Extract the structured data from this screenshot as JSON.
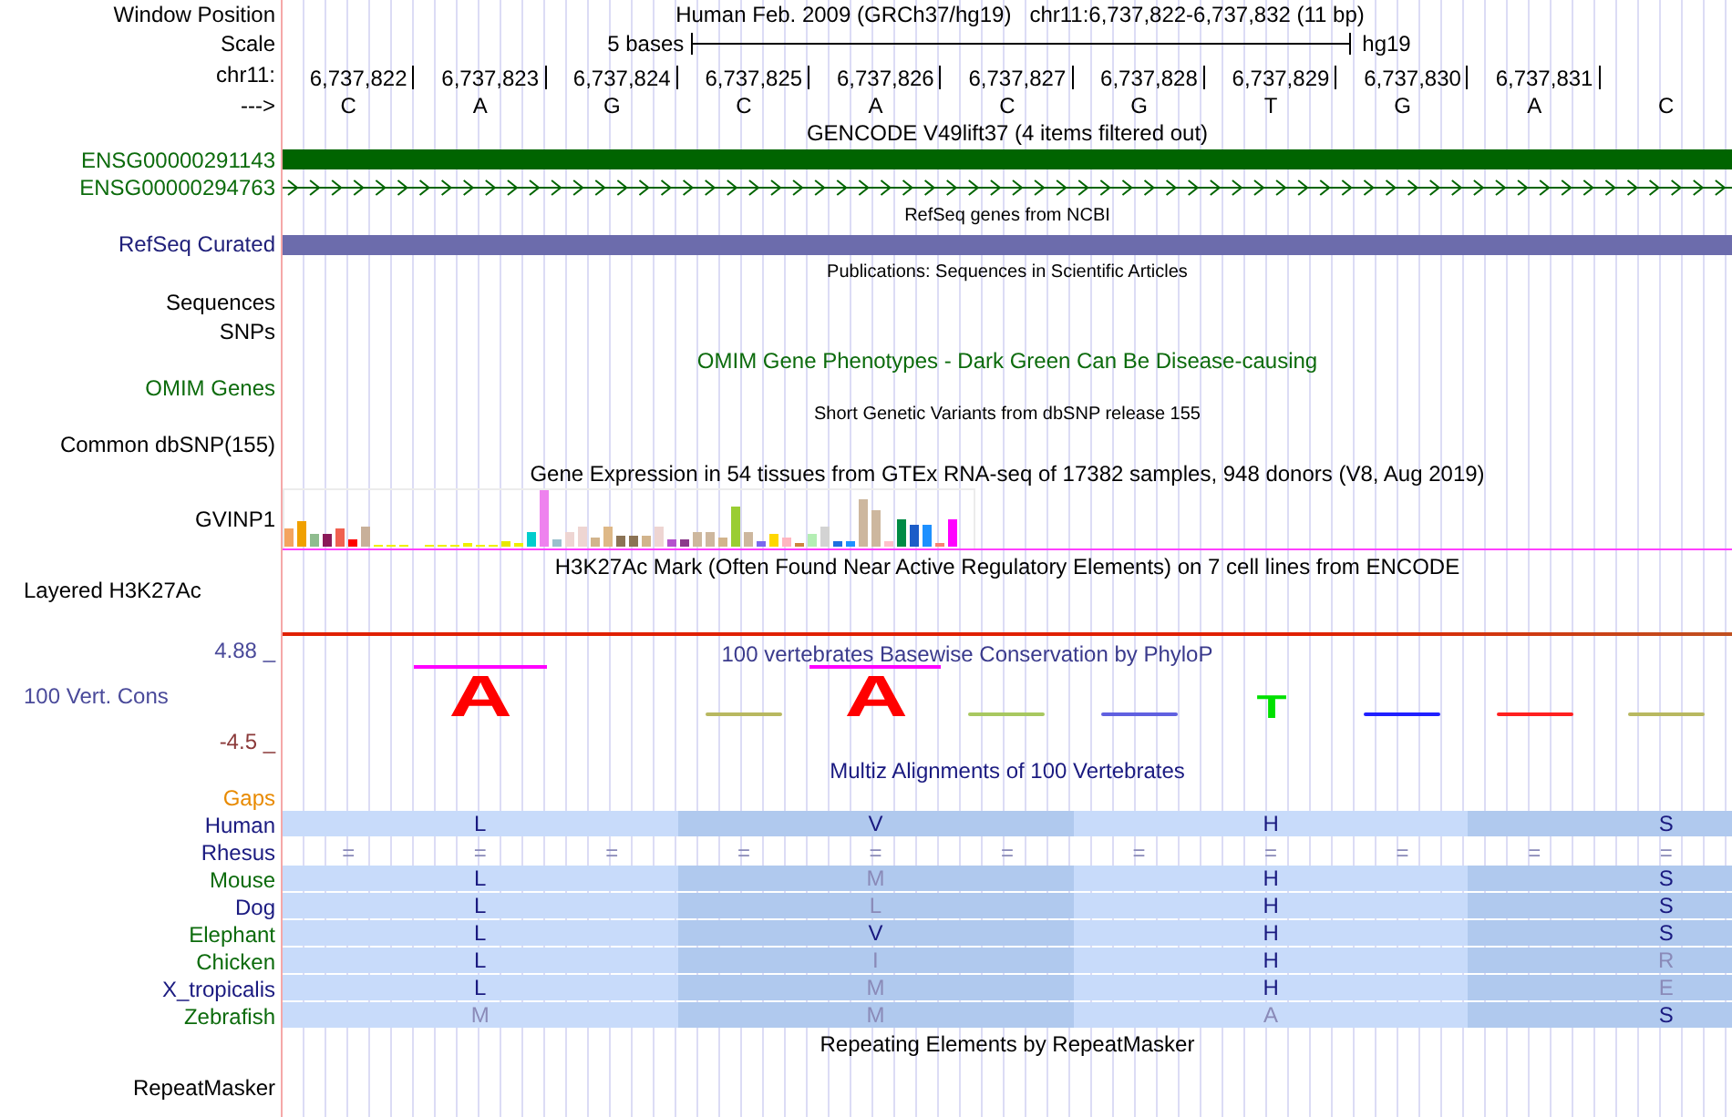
{
  "header": {
    "label": "Window Position",
    "assembly": "Human Feb. 2009 (GRCh37/hg19)",
    "region": "chr11:6,737,822-6,737,832 (11 bp)"
  },
  "scale": {
    "label": "Scale",
    "span": "5 bases",
    "assembly": "hg19"
  },
  "ruler": {
    "label": "chr11:",
    "positions": [
      "6,737,822",
      "6,737,823",
      "6,737,824",
      "6,737,825",
      "6,737,826",
      "6,737,827",
      "6,737,828",
      "6,737,829",
      "6,737,830",
      "6,737,831"
    ]
  },
  "sequence": {
    "label": "--->",
    "bases": [
      "C",
      "A",
      "G",
      "C",
      "A",
      "C",
      "G",
      "T",
      "G",
      "A",
      "C"
    ]
  },
  "rows": [
    {
      "kind": "title",
      "title": {
        "kind": "heading",
        "text": "GENCODE V49lift37 (4 items filtered out)",
        "color": "#000000"
      }
    },
    {
      "kind": "gene-block",
      "label": {
        "text": "ENSG00000291143",
        "color": "#0c6b0c"
      },
      "color": "#006400"
    },
    {
      "kind": "gene-intron",
      "label": {
        "text": "ENSG00000294763",
        "color": "#0c6b0c"
      },
      "color": "#006400"
    },
    {
      "kind": "title",
      "title": {
        "kind": "caption",
        "text": "RefSeq genes from NCBI",
        "color": "#000000"
      }
    },
    {
      "kind": "gene-block",
      "label": {
        "text": "RefSeq Curated",
        "color": "#20207a"
      },
      "color": "#6c6cac"
    },
    {
      "kind": "title",
      "title": {
        "kind": "caption",
        "text": "Publications: Sequences in Scientific Articles",
        "color": "#000000"
      }
    },
    {
      "kind": "empty",
      "label": {
        "text": "Sequences",
        "color": "#000000"
      }
    },
    {
      "kind": "empty",
      "label": {
        "text": "SNPs",
        "color": "#000000"
      }
    },
    {
      "kind": "title",
      "title": {
        "kind": "heading",
        "text": "OMIM Gene Phenotypes - Dark Green Can Be Disease-causing",
        "color": "#0c6b0c"
      }
    },
    {
      "kind": "empty",
      "label": {
        "text": "OMIM Genes",
        "color": "#0c6b0c"
      }
    },
    {
      "kind": "title",
      "title": {
        "kind": "caption",
        "text": "Short Genetic Variants from dbSNP release 155",
        "color": "#000000"
      }
    },
    {
      "kind": "empty",
      "label": {
        "text": "Common dbSNP(155)",
        "color": "#000000"
      }
    },
    {
      "kind": "title",
      "title": {
        "kind": "heading",
        "text": "Gene Expression in 54 tissues from GTEx RNA-seq of 17382 samples, 948 donors (V8, Aug 2019)",
        "color": "#000000"
      }
    },
    {
      "kind": "expression",
      "label": {
        "text": "GVINP1",
        "color": "#000000"
      }
    },
    {
      "kind": "signal",
      "label": {
        "text": "Layered H3K27Ac",
        "color": "#000000"
      },
      "title": {
        "kind": "heading",
        "text": "H3K27Ac Mark (Often Found Near Active Regulatory Elements) on 7 cell lines from ENCODE",
        "color": "#000000"
      }
    },
    {
      "kind": "conservation",
      "label": {
        "text": "100 Vert. Cons",
        "color": "#4a4a9a"
      },
      "top": {
        "text": "4.88 _",
        "color": "#4a4a9a"
      },
      "bottom": {
        "text": "-4.5 _",
        "color": "#8b3a3a"
      },
      "title": {
        "kind": "heading",
        "text": "100 vertebrates Basewise Conservation by PhyloP",
        "color": "#3a3a8c"
      },
      "columns": [
        {
          "kind": "none"
        },
        {
          "kind": "tall",
          "letter": "A",
          "color": "#ff0000",
          "clipped": true
        },
        {
          "kind": "none"
        },
        {
          "kind": "flat",
          "color": "#b8b860"
        },
        {
          "kind": "tall",
          "letter": "A",
          "color": "#ff0000",
          "clipped": true
        },
        {
          "kind": "flat",
          "color": "#a8c860"
        },
        {
          "kind": "flat",
          "color": "#6060e0"
        },
        {
          "kind": "short",
          "letter": "T",
          "color": "#00e000",
          "clipped": false
        },
        {
          "kind": "flat",
          "color": "#2020ff"
        },
        {
          "kind": "flat",
          "color": "#ff2020"
        },
        {
          "kind": "flat",
          "color": "#b8b860"
        }
      ]
    },
    {
      "kind": "title",
      "title": {
        "kind": "heading",
        "text": "Multiz Alignments of 100 Vertebrates",
        "color": "#1a1a80"
      }
    },
    {
      "kind": "empty",
      "label": {
        "text": "Gaps",
        "color": "#e88a00"
      }
    },
    {
      "kind": "alignment",
      "label": {
        "text": "Human",
        "color": "#1a1a80"
      },
      "codons": [
        {
          "aa": "L",
          "same": true
        },
        {
          "aa": "V",
          "same": true
        },
        {
          "aa": "H",
          "same": true
        },
        {
          "aa": "S",
          "same": true
        }
      ]
    },
    {
      "kind": "gaps",
      "label": {
        "text": "Rhesus",
        "color": "#1a1a80"
      },
      "marks": [
        "=",
        "=",
        "=",
        "=",
        "=",
        "=",
        "=",
        "=",
        "=",
        "=",
        "="
      ]
    },
    {
      "kind": "alignment",
      "label": {
        "text": "Mouse",
        "color": "#0c6b0c"
      },
      "codons": [
        {
          "aa": "L",
          "same": true
        },
        {
          "aa": "M",
          "same": false
        },
        {
          "aa": "H",
          "same": true
        },
        {
          "aa": "S",
          "same": true
        }
      ]
    },
    {
      "kind": "alignment",
      "label": {
        "text": "Dog",
        "color": "#1a1a80"
      },
      "codons": [
        {
          "aa": "L",
          "same": true
        },
        {
          "aa": "L",
          "same": false
        },
        {
          "aa": "H",
          "same": true
        },
        {
          "aa": "S",
          "same": true
        }
      ]
    },
    {
      "kind": "alignment",
      "label": {
        "text": "Elephant",
        "color": "#0c6b0c"
      },
      "codons": [
        {
          "aa": "L",
          "same": true
        },
        {
          "aa": "V",
          "same": true
        },
        {
          "aa": "H",
          "same": true
        },
        {
          "aa": "S",
          "same": true
        }
      ]
    },
    {
      "kind": "alignment",
      "label": {
        "text": "Chicken",
        "color": "#0c6b0c"
      },
      "codons": [
        {
          "aa": "L",
          "same": true
        },
        {
          "aa": "I",
          "same": false
        },
        {
          "aa": "H",
          "same": true
        },
        {
          "aa": "R",
          "same": false
        }
      ]
    },
    {
      "kind": "alignment",
      "label": {
        "text": "X_tropicalis",
        "color": "#1a1a80"
      },
      "codons": [
        {
          "aa": "L",
          "same": true
        },
        {
          "aa": "M",
          "same": false
        },
        {
          "aa": "H",
          "same": true
        },
        {
          "aa": "E",
          "same": false
        }
      ]
    },
    {
      "kind": "alignment",
      "label": {
        "text": "Zebrafish",
        "color": "#0c6b0c"
      },
      "codons": [
        {
          "aa": "M",
          "same": false
        },
        {
          "aa": "M",
          "same": false
        },
        {
          "aa": "A",
          "same": false
        },
        {
          "aa": "S",
          "same": true
        }
      ]
    },
    {
      "kind": "title",
      "title": {
        "kind": "heading",
        "text": "Repeating Elements by RepeatMasker",
        "color": "#000000"
      }
    },
    {
      "kind": "empty",
      "label": {
        "text": "RepeatMasker",
        "color": "#000000"
      }
    }
  ]
}
